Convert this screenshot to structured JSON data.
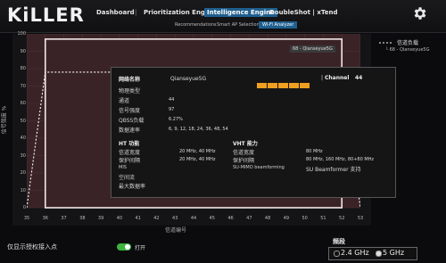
{
  "app": {
    "title": "KiLLER"
  },
  "nav": {
    "tabs": [
      "Dashboard",
      "Prioritization Engine",
      "Intelligence Engine",
      "DoubleShot | xTend"
    ],
    "active_tab": "Intelligence Engine",
    "subtabs": [
      "Recommendations",
      "Smart AP Selection",
      "Wi-Fi Analyzer"
    ],
    "active_subtab": "Wi-Fi Analyzer"
  },
  "icons": [
    "gear-icon"
  ],
  "chart_data": {
    "type": "area",
    "ylabel": "信号强度 %",
    "xlabel": "信道编号",
    "y_ticks": [
      "0",
      "10",
      "20",
      "30",
      "40",
      "50",
      "60",
      "70",
      "80",
      "90",
      "100"
    ],
    "x_ticks": [
      "35",
      "36",
      "37",
      "38",
      "39",
      "40",
      "41",
      "42",
      "43",
      "44",
      "45",
      "46",
      "47",
      "48",
      "49",
      "50",
      "51",
      "52",
      "53"
    ],
    "ylim": [
      0,
      100
    ],
    "series": [
      {
        "name": "68 - Qianseyue5G",
        "x": [
          36,
          52
        ],
        "y": [
          97,
          97
        ],
        "fill": "#3a2326",
        "color": "#f2e8e8"
      },
      {
        "name": "",
        "x": [
          35,
          36,
          52,
          53
        ],
        "y": [
          0,
          78,
          78,
          0
        ],
        "dashed": true,
        "color": "#ffffff"
      }
    ],
    "legend": {
      "title": "信道负载",
      "entry": "68 - Qianseyue5G",
      "position": "top-right"
    },
    "grid": true
  },
  "ssid_tag": "68 - Qianseyue5G",
  "popup": {
    "name_label": "网络名称",
    "name_value": "Qianseyue5G",
    "channel_label": "Channel",
    "channel_value": "44",
    "rows": [
      {
        "label": "物理类型",
        "value": ""
      },
      {
        "label": "通道",
        "value": "44"
      },
      {
        "label": "信号强度",
        "value": "97"
      },
      {
        "label": "QBSS负载",
        "value": "6.27%"
      },
      {
        "label": "数据速率",
        "value": "6, 9, 12, 18, 24, 36, 48, 54"
      }
    ],
    "ht_title": "HT 功能",
    "ht_rows": [
      {
        "label": "信道宽度",
        "value": "20 MHz, 40 MHz"
      },
      {
        "label": "保护间隔",
        "value": "20 MHz, 40 MHz"
      },
      {
        "label": "MIS",
        "value": ""
      },
      {
        "label": "空间流",
        "value": ""
      },
      {
        "label": "最大数据率",
        "value": ""
      }
    ],
    "vht_title": "VHT 能力",
    "vht_rows": [
      {
        "label": "信道宽度",
        "value": "80 MHz"
      },
      {
        "label": "保护间隔",
        "value": "80 MHz, 160 MHz, 80+80 MHz"
      },
      {
        "label": "SU-MIMO beamforming",
        "value": "SU Beamformer 支持"
      }
    ],
    "signal_bars": 5,
    "bar_color": "#f0a020"
  },
  "bottom": {
    "filter_label": "仅显示授权接入点",
    "toggle_label": "打开",
    "toggle_on": true,
    "band_title": "频段",
    "band_24": "2.4 GHz",
    "band_5": "5 GHz",
    "selected_band": "5 GHz"
  }
}
